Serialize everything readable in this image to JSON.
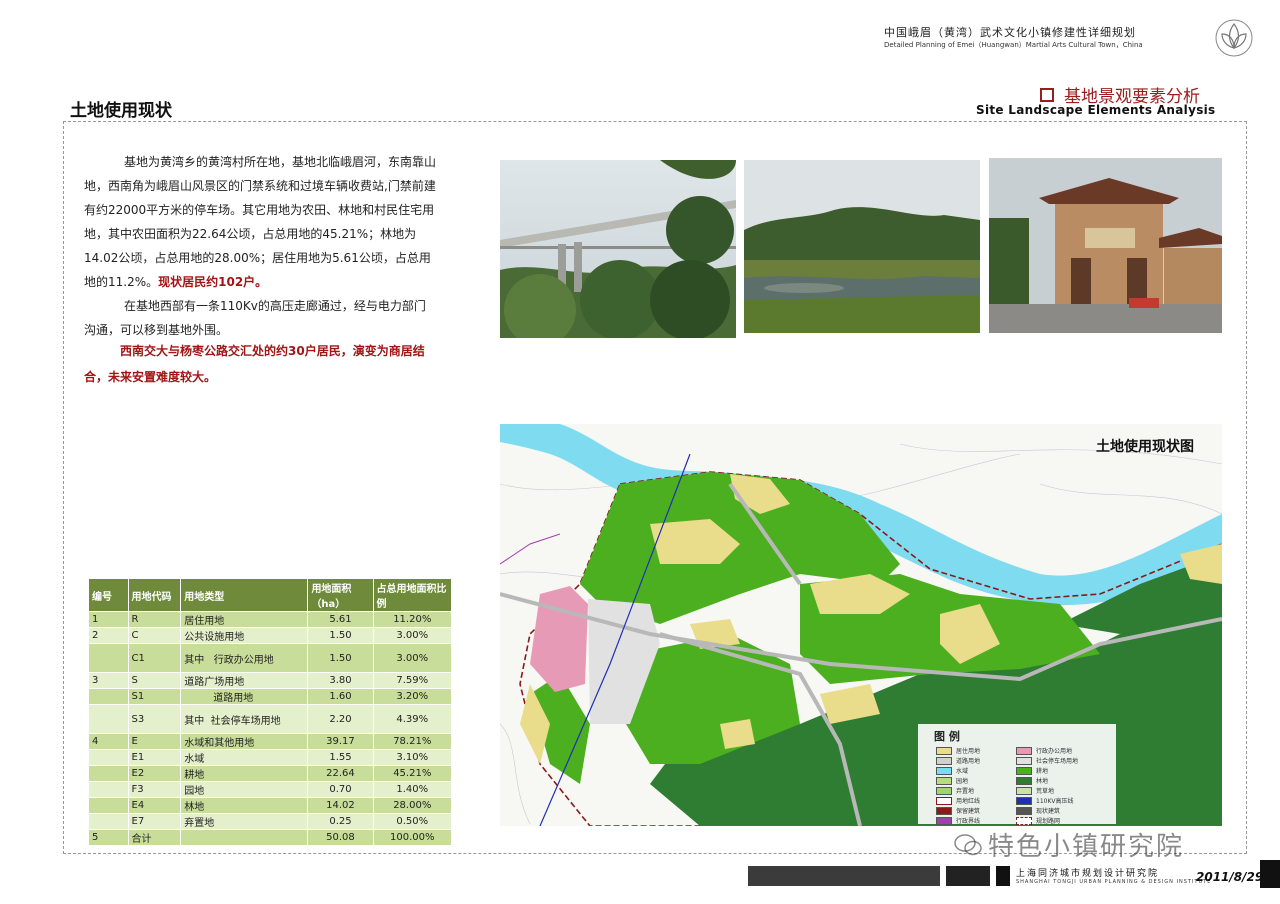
{
  "header": {
    "title_cn": "中国峨眉（黄湾）武术文化小镇修建性详细规划",
    "title_en": "Detailed Planning of Emei（Huangwan）Martial Arts Cultural Town，China"
  },
  "page_title": "土地使用现状",
  "section": {
    "title_cn": "基地景观要素分析",
    "title_en": "Site Landscape Elements Analysis"
  },
  "body": {
    "p1": "基地为黄湾乡的黄湾村所在地，基地北临峨眉河，东南靠山地，西南角为峨眉山风景区的门禁系统和过境车辆收费站,门禁前建有约22000平方米的停车场。其它用地为农田、林地和村民住宅用地，其中农田面积为22.64公顷，占总用地的45.21%；林地为14.02公顷，占总用地的28.00%；居住用地为5.61公顷，占总用地的11.2%。",
    "p1_highlight": "现状居民约102户。",
    "p2": "在基地西部有一条110Kv的高压走廊通过，经与电力部门沟通，可以移到基地外围。",
    "p3": "西南交大与杨枣公路交汇处的约30户居民，演变为商居结合，未来安置难度较大。"
  },
  "table": {
    "headers": [
      "编号",
      "用地代码",
      "用地类型",
      "用地面积（ha）",
      "占总用地面积比例"
    ],
    "rows": [
      {
        "no": "1",
        "code": "R",
        "sub": "",
        "type": "居住用地",
        "area": "5.61",
        "ratio": "11.20%"
      },
      {
        "no": "2",
        "code": "C",
        "sub": "",
        "type": "公共设施用地",
        "area": "1.50",
        "ratio": "3.00%"
      },
      {
        "no": "",
        "code": "C1",
        "sub": "其中",
        "type": "行政办公用地",
        "area": "1.50",
        "ratio": "3.00%"
      },
      {
        "no": "3",
        "code": "S",
        "sub": "",
        "type": "道路广场用地",
        "area": "3.80",
        "ratio": "7.59%"
      },
      {
        "no": "",
        "code": "S1",
        "sub": "其中",
        "type": "道路用地",
        "area": "1.60",
        "ratio": "3.20%"
      },
      {
        "no": "",
        "code": "S3",
        "sub": "",
        "type": "社会停车场用地",
        "area": "2.20",
        "ratio": "4.39%"
      },
      {
        "no": "4",
        "code": "E",
        "sub": "",
        "type": "水域和其他用地",
        "area": "39.17",
        "ratio": "78.21%"
      },
      {
        "no": "",
        "code": "E1",
        "sub": "",
        "type": "水域",
        "area": "1.55",
        "ratio": "3.10%"
      },
      {
        "no": "",
        "code": "E2",
        "sub": "",
        "type": "耕地",
        "area": "22.64",
        "ratio": "45.21%"
      },
      {
        "no": "",
        "code": "F3",
        "sub": "",
        "type": "园地",
        "area": "0.70",
        "ratio": "1.40%"
      },
      {
        "no": "",
        "code": "E4",
        "sub": "",
        "type": "林地",
        "area": "14.02",
        "ratio": "28.00%"
      },
      {
        "no": "",
        "code": "E7",
        "sub": "",
        "type": "弃置地",
        "area": "0.25",
        "ratio": "0.50%"
      },
      {
        "no": "5",
        "code": "合计",
        "sub": "",
        "type": "",
        "area": "50.08",
        "ratio": "100.00%"
      }
    ]
  },
  "map": {
    "title": "土地使用现状图",
    "legend_title": "图 例",
    "legend_left": [
      "居住用地",
      "道路用地",
      "水域",
      "园地",
      "弃置地",
      "用地红线",
      "保留建筑",
      "行政界线"
    ],
    "legend_right": [
      "行政办公用地",
      "社会停车场用地",
      "耕地",
      "林地",
      "荒草地",
      "110KV高压线",
      "现状建筑",
      "规划路网"
    ]
  },
  "watermark": "特色小镇研究院",
  "footer": {
    "org_cn": "上海同济城市规划设计研究院",
    "org_en": "SHANGHAI TONGJI URBAN PLANNING & DESIGN INSTITUTE",
    "date": "2011/8/29"
  },
  "colors": {
    "accent_red": "#9b1c1c",
    "table_header": "#6e8a3a",
    "farmland": "#4caf1f",
    "forest": "#2f7d32",
    "residential": "#e9dc8a",
    "water": "#7fdcf0",
    "admin": "#e79ab6"
  }
}
